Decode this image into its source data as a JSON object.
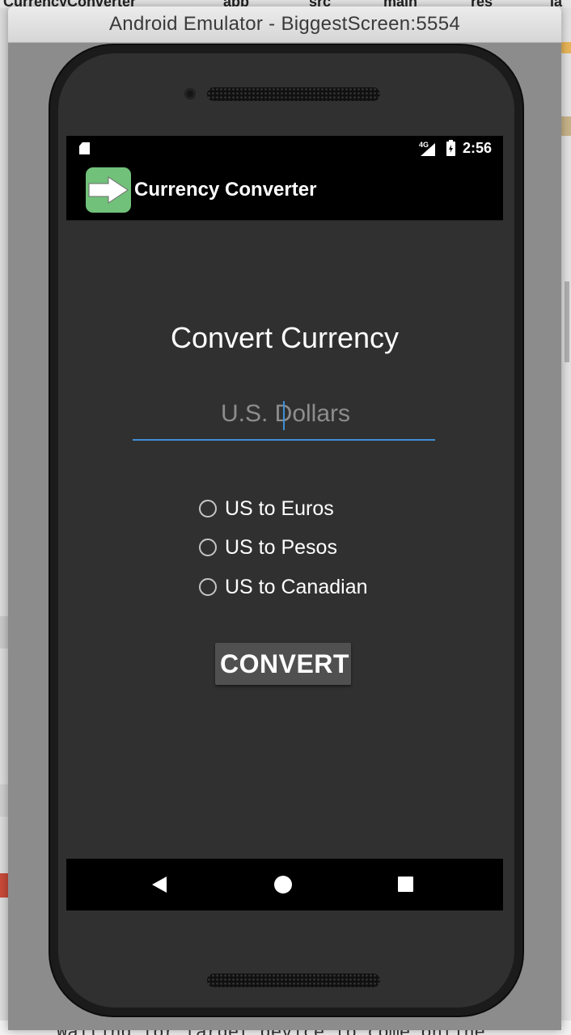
{
  "ide_background": {
    "top_tabs": [
      "CurrencyConverter",
      "app",
      "src",
      "main",
      "res",
      "la"
    ],
    "bottom_text": "Waiting for target device to come online"
  },
  "emulator": {
    "window_title": "Android Emulator - BiggestScreen:5554"
  },
  "status_bar": {
    "network": "4G",
    "time": "2:56"
  },
  "app_bar": {
    "title": "Currency Converter",
    "icon": "arrow-right-icon"
  },
  "main": {
    "heading": "Convert Currency",
    "amount_field": {
      "value": "",
      "placeholder": "U.S. Dollars"
    },
    "options": [
      {
        "label": "US to Euros",
        "selected": false
      },
      {
        "label": "US to Pesos",
        "selected": false
      },
      {
        "label": "US to Canadian",
        "selected": false
      }
    ],
    "convert_button": "CONVERT"
  },
  "nav_bar": {
    "buttons": [
      "back",
      "home",
      "recents"
    ]
  },
  "colors": {
    "screen_background": "#303030",
    "app_bar": "#000000",
    "accent": "#3e8fd8",
    "app_icon": "#72c17a",
    "button": "#505050"
  }
}
